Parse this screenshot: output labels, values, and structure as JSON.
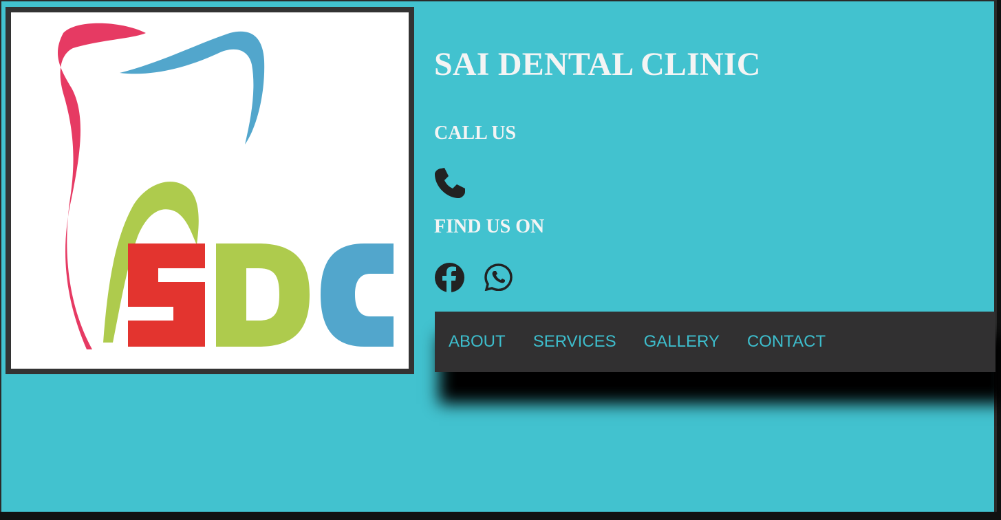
{
  "logo": {
    "letters": "SDC",
    "colors": {
      "tooth_outline_pink": "#e63a63",
      "tooth_outline_blue": "#52a6cc",
      "arc_green": "#aecb4d",
      "s_red": "#e3342f",
      "d_green": "#aecb4d",
      "c_blue": "#52a6cc"
    }
  },
  "header": {
    "title": "SAI DENTAL CLINIC",
    "call_heading": "CALL US",
    "find_heading": "FIND US ON"
  },
  "icons": {
    "phone": "phone-icon",
    "facebook": "facebook-icon",
    "whatsapp": "whatsapp-icon"
  },
  "nav": {
    "items": [
      {
        "label": "ABOUT"
      },
      {
        "label": "SERVICES"
      },
      {
        "label": "GALLERY"
      },
      {
        "label": "CONTACT"
      }
    ]
  },
  "colors": {
    "background": "#42c2cf",
    "nav_background": "#313031",
    "nav_link": "#3dbdcc",
    "heading_text": "#f4f4f4",
    "icon": "#222222"
  }
}
